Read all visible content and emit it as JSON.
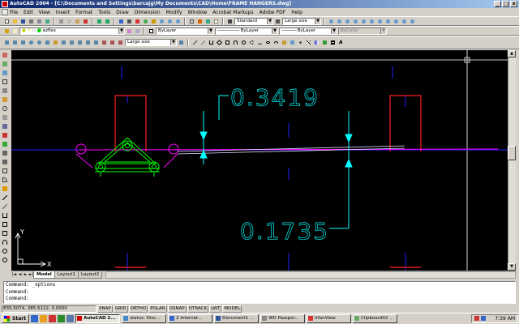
{
  "window": {
    "title": "AutoCAD 2004 - [C:\\Documents and Settings\\barcajg\\My Documents\\CAD\\Home\\FRAME HANGERS.dwg]",
    "minimize": "_",
    "restore": "□",
    "close": "x"
  },
  "menu": [
    "File",
    "Edit",
    "View",
    "Insert",
    "Format",
    "Tools",
    "Draw",
    "Dimension",
    "Modify",
    "Window",
    "Acrobat Markups",
    "Adobe PDF",
    "Help"
  ],
  "toolbars": {
    "text_style": "Standard",
    "dim_style": "Large size",
    "layer": "ezflex",
    "color": "ByLayer",
    "linetype": "ByLayer",
    "lineweight": "ByLayer",
    "plot_style": "ByColor",
    "dim_style_2": "Large size"
  },
  "drawing": {
    "dim_upper": "0.3419",
    "dim_lower": "0.1735",
    "ucs_y": "Y",
    "ucs_x": "X"
  },
  "tabs": {
    "nav_first": "|◄",
    "nav_prev": "◄",
    "nav_next": "►",
    "nav_last": "►|",
    "model": "Model",
    "layout1": "Layout1",
    "layout2": "Layout2"
  },
  "command": {
    "line1": "Command: _options",
    "line2": "Command:",
    "line3": "Command:"
  },
  "status": {
    "coords": "835.5074, 385.6122, 0.0000",
    "modes": [
      "SNAP",
      "GRID",
      "ORTHO",
      "POLAR",
      "OSNAP",
      "OTRACK",
      "LWT",
      "MODEL"
    ]
  },
  "taskbar": {
    "start": "Start",
    "tasks": [
      {
        "label": "AutoCAD 2...",
        "active": true
      },
      {
        "label": "status: Disc..."
      },
      {
        "label": "2 Internet..."
      },
      {
        "label": "Document1 ..."
      },
      {
        "label": "WD Passpor..."
      },
      {
        "label": "IrfanView"
      },
      {
        "label": "Clipboard02 ..."
      }
    ],
    "time": "7:39 AM"
  },
  "colors": {
    "dimension": "#00ffff",
    "frame_red": "#ff2020",
    "hanger_green": "#00ff00",
    "circles_magenta": "#ff00ff",
    "centerline_blue": "#2020ff"
  }
}
